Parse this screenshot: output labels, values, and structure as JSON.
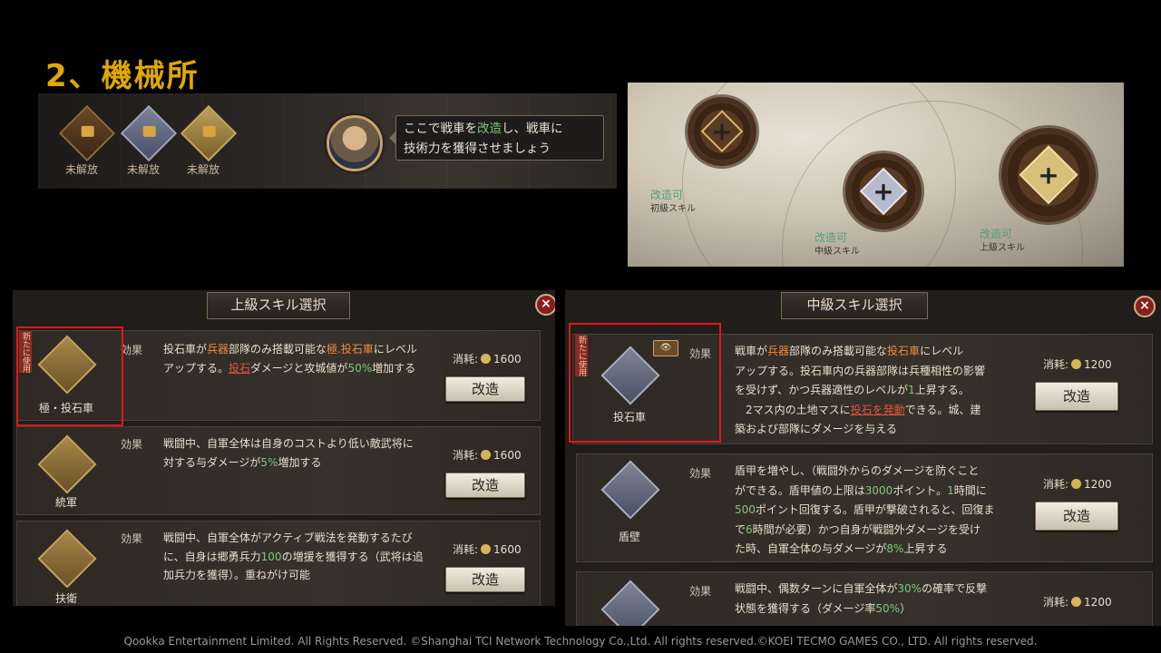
{
  "title": "2、機械所",
  "strip": {
    "slots": [
      "未解放",
      "未解放",
      "未解放"
    ],
    "bubble_line1_a": "ここで戦車を",
    "bubble_line1_hl": "改造",
    "bubble_line1_b": "し、戦車に",
    "bubble_line2": "技術力を獲得させましょう"
  },
  "gears": {
    "g1_status": "改造可",
    "g1_label": "初級スキル",
    "g2_status": "改造可",
    "g2_label": "中級スキル",
    "g3_status": "改造可",
    "g3_label": "上級スキル"
  },
  "left_panel": {
    "title": "上級スキル選択",
    "ribbon": "新たに使用",
    "effect_label": "効果",
    "cost_label": "消耗:",
    "button": "改造",
    "cards": [
      {
        "name": "極・投石車",
        "cost": "1600",
        "d1": "投石車が",
        "d1h": "兵器",
        "d1b": "部隊のみ搭載可能な",
        "d1h2": "極.投石車",
        "d1c": "にレベル",
        "d2": "アップする。",
        "d2h": "投石",
        "d2b": "ダメージと攻城値が",
        "d2h2": "50%",
        "d2c": "増加する"
      },
      {
        "name": "統軍",
        "cost": "1600",
        "d1": "戦闘中、自軍全体は自身のコストより低い敵武将に",
        "d2": "対する与ダメージが",
        "d2h": "5%",
        "d2b": "増加する"
      },
      {
        "name": "扶衛",
        "cost": "1600",
        "d1": "戦闘中、自軍全体がアクティブ戦法を発動するたび",
        "d2": "に、自身は郷勇兵力",
        "d2h": "100",
        "d2b": "の増援を獲得する（武将は追",
        "d3": "加兵力を獲得）。重ねがけ可能"
      }
    ]
  },
  "right_panel": {
    "title": "中級スキル選択",
    "ribbon": "新たに使用",
    "eye": "👁",
    "effect_label": "効果",
    "cost_label": "消耗:",
    "button": "改造",
    "cards": [
      {
        "name": "投石車",
        "cost": "1200",
        "d1a": "戦車が",
        "d1h": "兵器",
        "d1b": "部隊のみ搭載可能な",
        "d1h2": "投石車",
        "d1c": "にレベル",
        "d2": "アップする。投石車内の兵器部隊は兵種相性の影響",
        "d3a": "を受けず、かつ兵器適性のレベルが",
        "d3h": "1",
        "d3b": "上昇する。",
        "d4a": "　2マス内の土地マスに",
        "d4h": "投石を発動",
        "d4b": "できる。城、建",
        "d5": "築および部隊にダメージを与える"
      },
      {
        "name": "盾壁",
        "cost": "1200",
        "d1": "盾甲を増やし、（戦闘外からのダメージを防ぐこと",
        "d2a": "ができる。盾甲値の上限は",
        "d2h": "3000",
        "d2b": "ポイント。",
        "d2h2": "1",
        "d2c": "時間に",
        "d3h": "500",
        "d3b": "ポイント回復する。盾甲が撃破されると、回復ま",
        "d4a": "で",
        "d4h": "6",
        "d4b": "時間が必要）かつ自身が戦闘外ダメージを受け",
        "d5a": "た時、自軍全体の与ダメージが",
        "d5h": "8%",
        "d5b": "上昇する"
      },
      {
        "name": "",
        "cost": "1200",
        "d1a": "戦闘中、偶数ターンに自軍全体が",
        "d1h": "30%",
        "d1b": "の確率で反撃",
        "d2a": "状態を獲得する（ダメージ率",
        "d2h": "50%",
        "d2b": "）"
      }
    ]
  },
  "footer": "Qookka Entertainment Limited. All Rights Reserved. ©Shanghai TCI Network Technology Co.,Ltd. All rights reserved.©KOEI TECMO GAMES CO., LTD. All rights reserved."
}
